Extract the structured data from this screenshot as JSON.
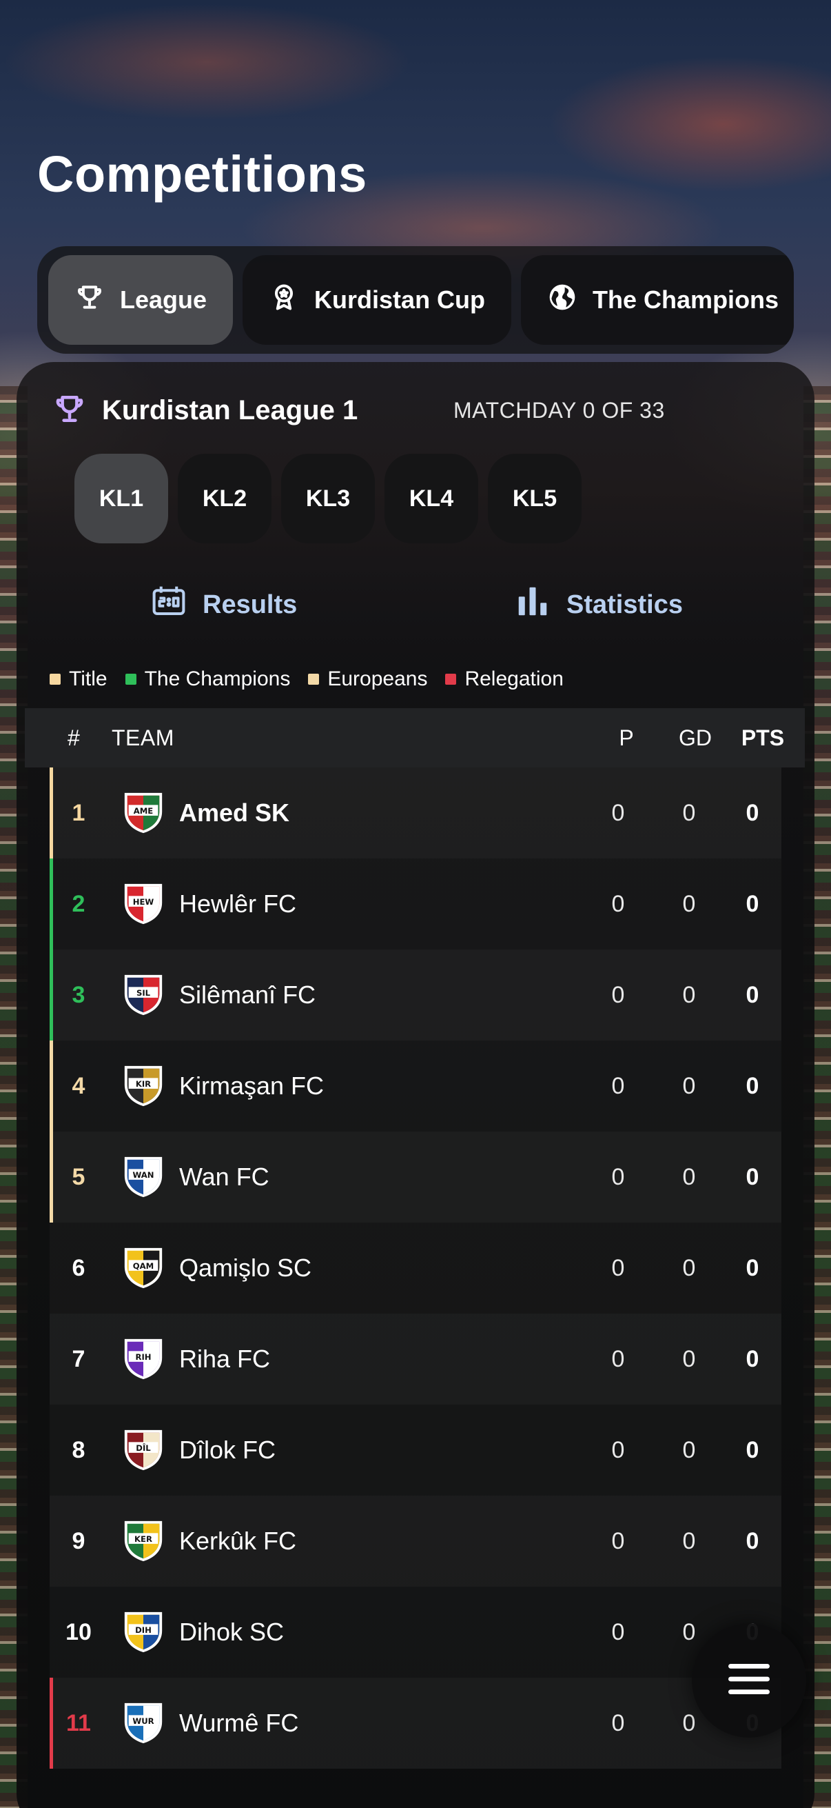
{
  "page": {
    "title": "Competitions"
  },
  "tabs": [
    {
      "label": "League",
      "icon": "trophy-icon",
      "active": true
    },
    {
      "label": "Kurdistan Cup",
      "icon": "medal-icon",
      "active": false
    },
    {
      "label": "The Champions",
      "icon": "globe-icon",
      "active": false
    }
  ],
  "league": {
    "name": "Kurdistan League 1",
    "matchday": "MATCHDAY 0 OF 33",
    "divisions": [
      "KL1",
      "KL2",
      "KL3",
      "KL4",
      "KL5"
    ],
    "active_division": "KL1"
  },
  "actions": {
    "results": "Results",
    "statistics": "Statistics"
  },
  "legend": [
    {
      "label": "Title",
      "color": "#f6d7a0"
    },
    {
      "label": "The Champions",
      "color": "#2fbf5a"
    },
    {
      "label": "Europeans",
      "color": "#f3d9a7"
    },
    {
      "label": "Relegation",
      "color": "#e23b4a"
    }
  ],
  "table": {
    "headers": {
      "num": "#",
      "team": "TEAM",
      "p": "P",
      "gd": "GD",
      "pts": "PTS"
    },
    "rows": [
      {
        "pos": "1",
        "abbr": "AME",
        "team": "Amed SK",
        "p": "0",
        "gd": "0",
        "pts": "0",
        "zone": "#f6d7a0",
        "crest": [
          "#d22b2b",
          "#1f7a3a",
          "#ffffff"
        ]
      },
      {
        "pos": "2",
        "abbr": "HEW",
        "team": "Hewlêr FC",
        "p": "0",
        "gd": "0",
        "pts": "0",
        "zone": "#2fbf5a",
        "crest": [
          "#d8262f",
          "#ffffff",
          "#ffffff"
        ]
      },
      {
        "pos": "3",
        "abbr": "SIL",
        "team": "Silêmanî FC",
        "p": "0",
        "gd": "0",
        "pts": "0",
        "zone": "#2fbf5a",
        "crest": [
          "#1c2a56",
          "#d8262f",
          "#ffffff"
        ]
      },
      {
        "pos": "4",
        "abbr": "KIR",
        "team": "Kirmaşan FC",
        "p": "0",
        "gd": "0",
        "pts": "0",
        "zone": "#f3d9a7",
        "crest": [
          "#2a2a2a",
          "#c89a2a",
          "#ffffff"
        ]
      },
      {
        "pos": "5",
        "abbr": "WAN",
        "team": "Wan FC",
        "p": "0",
        "gd": "0",
        "pts": "0",
        "zone": "#f3d9a7",
        "crest": [
          "#1a4fa0",
          "#ffffff",
          "#ffffff"
        ]
      },
      {
        "pos": "6",
        "abbr": "QAM",
        "team": "Qamişlo SC",
        "p": "0",
        "gd": "0",
        "pts": "0",
        "zone": "",
        "crest": [
          "#f2c21b",
          "#1a1a1a",
          "#ffffff"
        ]
      },
      {
        "pos": "7",
        "abbr": "RIH",
        "team": "Riha FC",
        "p": "0",
        "gd": "0",
        "pts": "0",
        "zone": "",
        "crest": [
          "#6a2bb8",
          "#ffffff",
          "#ffffff"
        ]
      },
      {
        "pos": "8",
        "abbr": "DÎL",
        "team": "Dîlok FC",
        "p": "0",
        "gd": "0",
        "pts": "0",
        "zone": "",
        "crest": [
          "#8a1c22",
          "#f3e6c8",
          "#ffffff"
        ]
      },
      {
        "pos": "9",
        "abbr": "KER",
        "team": "Kerkûk FC",
        "p": "0",
        "gd": "0",
        "pts": "0",
        "zone": "",
        "crest": [
          "#1f7a3a",
          "#f2c21b",
          "#ffffff"
        ]
      },
      {
        "pos": "10",
        "abbr": "DIH",
        "team": "Dihok SC",
        "p": "0",
        "gd": "0",
        "pts": "0",
        "zone": "",
        "crest": [
          "#f2c21b",
          "#1a4fa0",
          "#ffffff"
        ]
      },
      {
        "pos": "11",
        "abbr": "WUR",
        "team": "Wurmê FC",
        "p": "0",
        "gd": "0",
        "pts": "0",
        "zone": "#e23b4a",
        "crest": [
          "#1a6fb8",
          "#ffffff",
          "#ffffff"
        ]
      }
    ]
  },
  "fab": {
    "icon": "menu-icon"
  }
}
